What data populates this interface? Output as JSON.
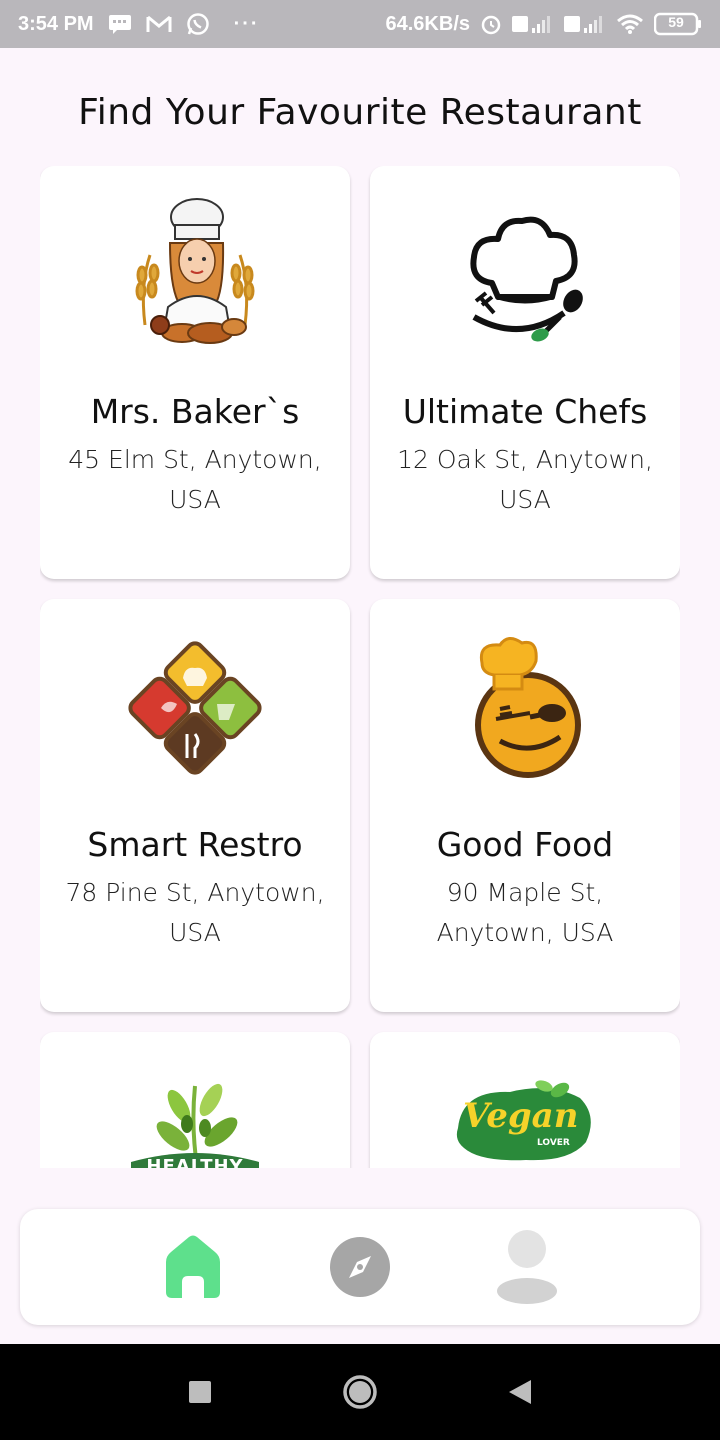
{
  "status_bar": {
    "time": "3:54 PM",
    "ellipsis": "···",
    "net_speed": "64.6KB/s",
    "battery": "59"
  },
  "header": {
    "title": "Find Your Favourite Restaurant"
  },
  "restaurants": [
    {
      "name": "Mrs. Baker`s",
      "address": "45 Elm St, Anytown, USA",
      "logo": "baker-logo"
    },
    {
      "name": "Ultimate Chefs",
      "address": "12 Oak St, Anytown, USA",
      "logo": "chef-hat-logo"
    },
    {
      "name": "Smart Restro",
      "address": "78 Pine St, Anytown, USA",
      "logo": "smart-restro-logo"
    },
    {
      "name": "Good Food",
      "address": "90 Maple St, Anytown, USA",
      "logo": "good-food-logo"
    },
    {
      "name": "",
      "address": "",
      "logo": "healthy-logo",
      "logo_text": "HEALTHY"
    },
    {
      "name": "",
      "address": "",
      "logo": "vegan-logo",
      "logo_text": "Vegan",
      "logo_subtext": "LOVER"
    }
  ],
  "bottom_nav": {
    "items": [
      "home-icon",
      "compass-icon",
      "profile-icon"
    ],
    "active_color": "#5ee08c",
    "inactive_color": "#a6a6a6"
  },
  "colors": {
    "background": "#fcf5fc",
    "status_bar": "#b9b7bb"
  }
}
